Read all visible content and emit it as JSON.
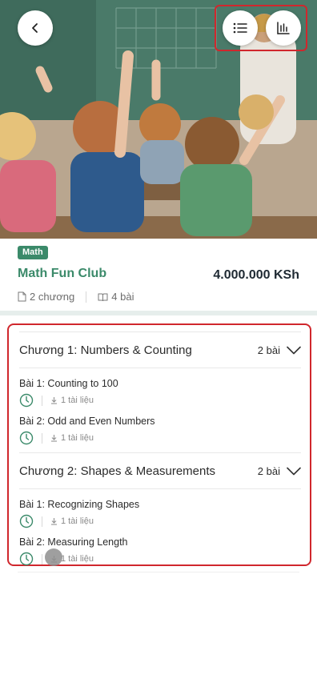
{
  "header": {
    "back_icon": "chevron-left-icon",
    "list_icon": "list-icon",
    "chart_icon": "bar-chart-icon"
  },
  "course": {
    "tag": "Math",
    "title": "Math Fun Club",
    "price": "4.000.000 KSh",
    "chapters_count": "2 chương",
    "lessons_count": "4 bài"
  },
  "chapters": [
    {
      "title": "Chương 1: Numbers & Counting",
      "count": "2 bài",
      "lessons": [
        {
          "title": "Bài 1: Counting to 100",
          "docs": "1 tài liệu"
        },
        {
          "title": "Bài 2: Odd and Even Numbers",
          "docs": "1 tài liệu"
        }
      ]
    },
    {
      "title": "Chương 2: Shapes & Measurements",
      "count": "2 bài",
      "lessons": [
        {
          "title": "Bài 1: Recognizing Shapes",
          "docs": "1 tài liệu"
        },
        {
          "title": "Bài 2: Measuring Length",
          "docs": "1 tài liệu"
        }
      ]
    }
  ],
  "colors": {
    "accent": "#3b8a6a",
    "highlight": "#d0272d",
    "price": "#1f2a33"
  }
}
